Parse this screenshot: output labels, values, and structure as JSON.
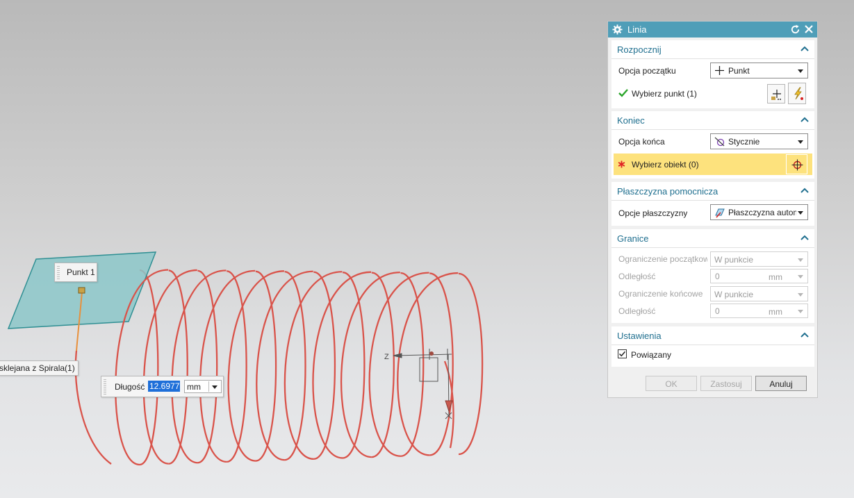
{
  "viewport": {
    "point_label": "Punkt 1",
    "body_label": "sklejana z Spirala(1)",
    "length_label": "Długość",
    "length_value": "12.6977",
    "length_unit": "mm",
    "axis_label": "Z",
    "helix_color": "#d9534a",
    "plane_color": "#8cc7c9"
  },
  "dialog": {
    "title": "Linia",
    "sections": {
      "start": {
        "title": "Rozpocznij",
        "option_label": "Opcja początku",
        "option_value": "Punkt",
        "select_label": "Wybierz punkt (1)"
      },
      "end": {
        "title": "Koniec",
        "option_label": "Opcja końca",
        "option_value": "Stycznie",
        "select_label": "Wybierz obiekt (0)"
      },
      "plane": {
        "title": "Płaszczyzna pomocnicza",
        "option_label": "Opcje płaszczyzny",
        "option_value": "Płaszczyzna autom"
      },
      "limits": {
        "title": "Granice",
        "start_limit_label": "Ograniczenie początkow",
        "start_limit_value": "W punkcie",
        "distance1_label": "Odległość",
        "distance1_value": "0",
        "distance1_unit": "mm",
        "end_limit_label": "Ograniczenie końcowe",
        "end_limit_value": "W punkcie",
        "distance2_label": "Odległość",
        "distance2_value": "0",
        "distance2_unit": "mm"
      },
      "settings": {
        "title": "Ustawienia",
        "associative_label": "Powiązany",
        "associative_checked": true
      }
    },
    "buttons": {
      "ok": "OK",
      "apply": "Zastosuj",
      "cancel": "Anuluj"
    }
  },
  "colors": {
    "titlebar": "#4f9eb8",
    "section_title": "#1f6f8f",
    "highlight": "#fde27d",
    "check_green": "#2aa52a",
    "required_red": "#e02424"
  }
}
